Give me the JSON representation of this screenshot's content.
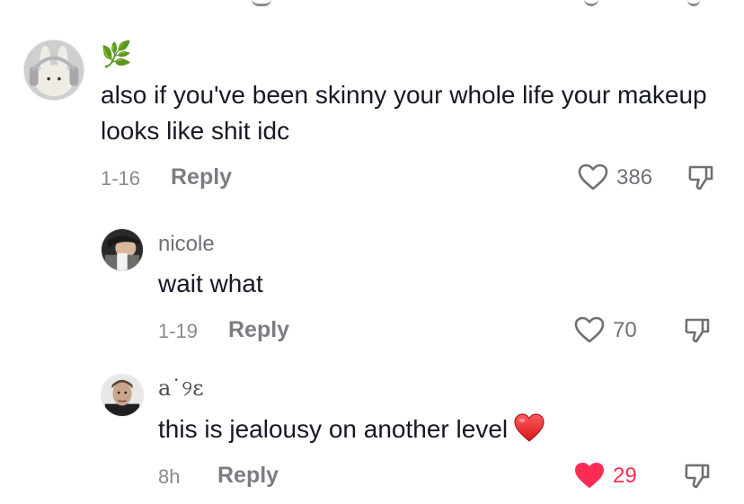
{
  "comments": [
    {
      "username": "🌿",
      "text": "also if you've been skinny your whole life your makeup looks like shit idc",
      "date": "1-16",
      "reply_label": "Reply",
      "likes": "386",
      "liked": false
    },
    {
      "username": "nicole",
      "text": "wait what",
      "date": "1-19",
      "reply_label": "Reply",
      "likes": "70",
      "liked": false
    },
    {
      "username": "a˙୨ɛ",
      "text": "this is jealousy on another level",
      "text_emoji": "red-heart-emoji",
      "date": "8h",
      "reply_label": "Reply",
      "likes": "29",
      "liked": true
    }
  ],
  "colors": {
    "liked_heart": "#fe2c55",
    "text": "#161823",
    "muted": "#8a8b91"
  }
}
